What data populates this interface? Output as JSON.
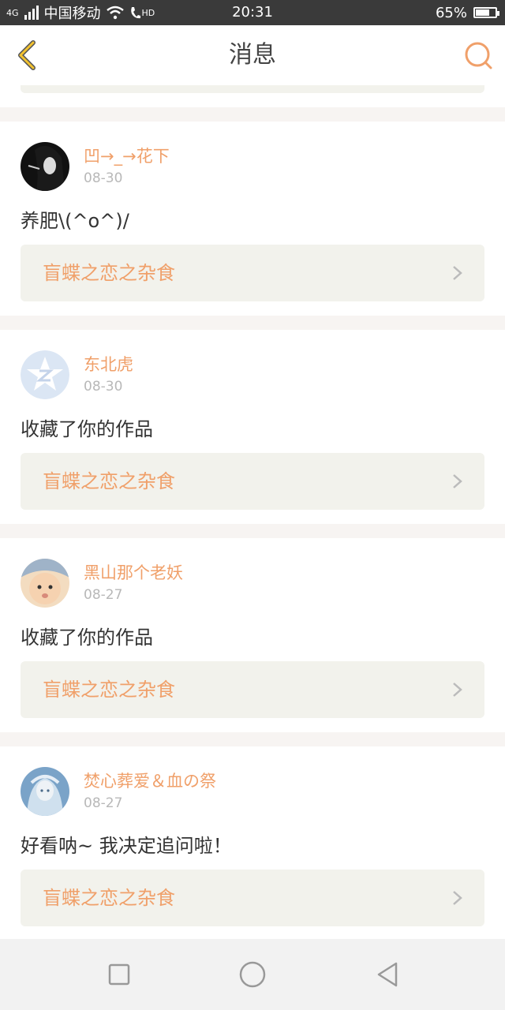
{
  "status_bar": {
    "network": "4G",
    "carrier": "中国移动",
    "hd": "HD",
    "time": "20:31",
    "battery": "65%",
    "battery_level": 0.65
  },
  "header": {
    "title": "消息",
    "back_icon": "chevron-left-icon",
    "search_icon": "search-icon"
  },
  "messages": [
    {
      "user": "凹→_→花下",
      "date": "08-30",
      "text": "养肥\\(^o^)/",
      "work_title": "盲蝶之恋之杂食"
    },
    {
      "user": "东北虎",
      "date": "08-30",
      "text": "收藏了你的作品",
      "work_title": "盲蝶之恋之杂食"
    },
    {
      "user": "黑山那个老妖",
      "date": "08-27",
      "text": "收藏了你的作品",
      "work_title": "盲蝶之恋之杂食"
    },
    {
      "user": "焚心葬爱＆血の祭",
      "date": "08-27",
      "text": "好看呐~ 我决定追问啦！",
      "work_title": "盲蝶之恋之杂食"
    }
  ],
  "nav_bar": {
    "icons": [
      "square-icon",
      "circle-home-icon",
      "triangle-back-icon"
    ]
  },
  "colors": {
    "accent": "#f0a06a",
    "back_chevron": "#f2c230",
    "card_bg": "#ffffff",
    "work_bg": "#f2f2ec"
  }
}
